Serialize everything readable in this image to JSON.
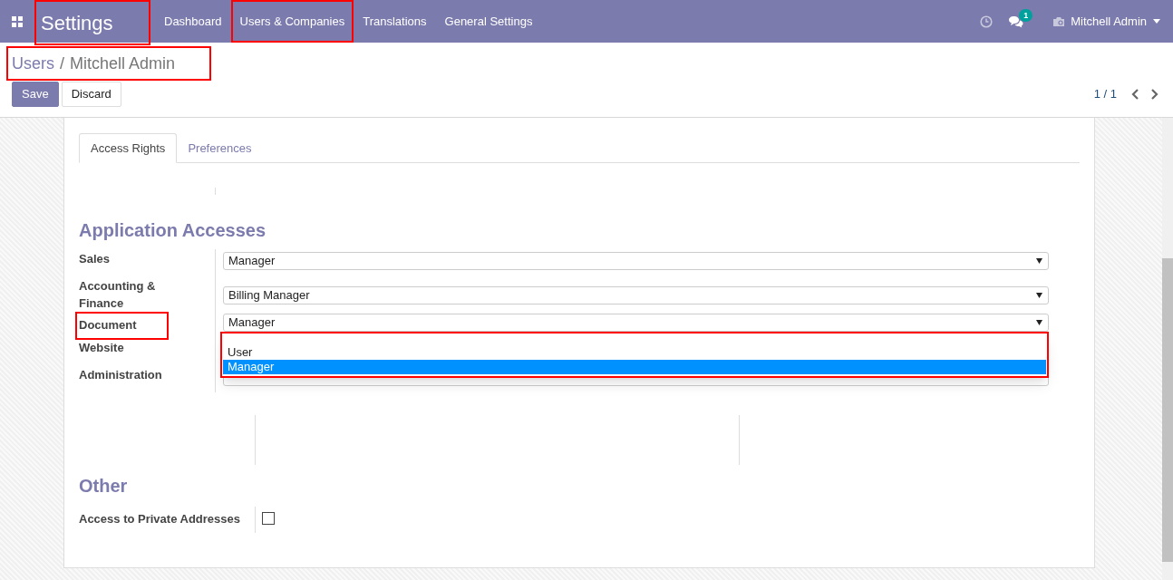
{
  "app": {
    "title": "Settings",
    "highlighted": true
  },
  "menu": [
    {
      "label": "Dashboard",
      "highlighted": false
    },
    {
      "label": "Users & Companies",
      "highlighted": true
    },
    {
      "label": "Translations",
      "highlighted": false
    },
    {
      "label": "General Settings",
      "highlighted": false
    }
  ],
  "systray": {
    "message_count": "1",
    "user": "Mitchell Admin"
  },
  "breadcrumb": {
    "items": [
      "Users",
      "Mitchell Admin"
    ],
    "separator": "/",
    "highlighted": true
  },
  "buttons": [
    {
      "label": "Save",
      "kind": "primary"
    },
    {
      "label": "Discard",
      "kind": "secondary"
    }
  ],
  "pager": "1 / 1",
  "tabs": [
    {
      "label": "Access Rights",
      "selected": true
    },
    {
      "label": "Preferences",
      "selected": false
    }
  ],
  "application_accesses": {
    "title": "Application Accesses",
    "rows": [
      {
        "kind": "select",
        "label": "Sales",
        "value": "Manager",
        "highlighted": false
      },
      {
        "kind": "select",
        "label": "Accounting & Finance",
        "value": "Billing Manager",
        "highlighted": false
      },
      {
        "kind": "select",
        "label": "Document",
        "value": "Manager",
        "highlighted": true,
        "dropdown": {
          "highlighted": true,
          "options": [
            {
              "label": "User",
              "selected": false
            },
            {
              "label": "Manager",
              "selected": true
            }
          ]
        }
      },
      {
        "kind": "label",
        "label": "Website",
        "highlighted": false
      },
      {
        "kind": "select",
        "label": "Administration",
        "highlighted": false
      }
    ]
  },
  "other": {
    "title": "Other",
    "fields": [
      {
        "label": "Access to Private Addresses",
        "checked": false
      }
    ]
  }
}
